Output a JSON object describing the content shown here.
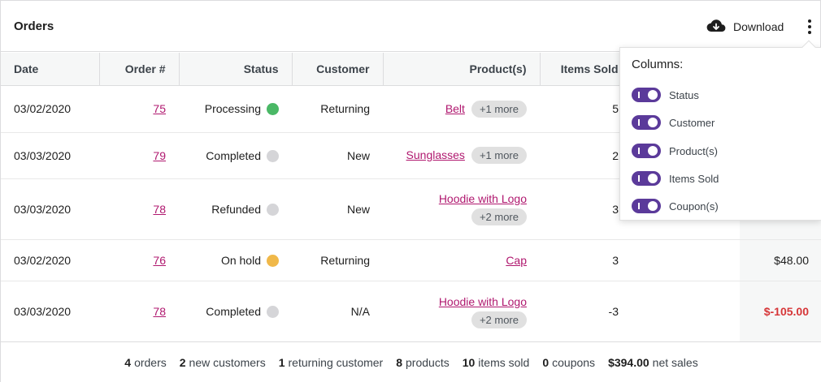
{
  "header": {
    "title": "Orders",
    "download_label": "Download",
    "download_icon": "cloud-download-icon",
    "menu_icon": "vertical-ellipsis-icon"
  },
  "columns": [
    "Date",
    "Order #",
    "Status",
    "Customer",
    "Product(s)",
    "Items Sold"
  ],
  "rows": [
    {
      "date": "03/02/2020",
      "order": "75",
      "status": "Processing",
      "status_color": "#4ab866",
      "customer": "Returning",
      "product": "Belt",
      "more": "+1 more",
      "items": "5",
      "net": ""
    },
    {
      "date": "03/03/2020",
      "order": "79",
      "status": "Completed",
      "status_color": "#d5d5d8",
      "customer": "New",
      "product": "Sunglasses",
      "more": "+1 more",
      "items": "2",
      "net": ""
    },
    {
      "date": "03/03/2020",
      "order": "78",
      "status": "Refunded",
      "status_color": "#d5d5d8",
      "customer": "New",
      "product": "Hoodie with Logo",
      "more": "+2 more",
      "items": "3",
      "net": ""
    },
    {
      "date": "03/02/2020",
      "order": "76",
      "status": "On hold",
      "status_color": "#f0b849",
      "customer": "Returning",
      "product": "Cap",
      "more": "",
      "items": "3",
      "net": "$48.00"
    },
    {
      "date": "03/03/2020",
      "order": "78",
      "status": "Completed",
      "status_color": "#d5d5d8",
      "customer": "N/A",
      "product": "Hoodie with Logo",
      "more": "+2 more",
      "items": "-3",
      "net": "$-105.00"
    }
  ],
  "summary": [
    {
      "value": "4",
      "label": "orders"
    },
    {
      "value": "2",
      "label": "new customers"
    },
    {
      "value": "1",
      "label": "returning customer"
    },
    {
      "value": "8",
      "label": "products"
    },
    {
      "value": "10",
      "label": "items sold"
    },
    {
      "value": "0",
      "label": "coupons"
    },
    {
      "value": "$394.00",
      "label": "net sales"
    }
  ],
  "popover": {
    "title": "Columns:",
    "toggles": [
      {
        "label": "Status",
        "on": true
      },
      {
        "label": "Customer",
        "on": true
      },
      {
        "label": "Product(s)",
        "on": true
      },
      {
        "label": "Items Sold",
        "on": true
      },
      {
        "label": "Coupon(s)",
        "on": true
      }
    ]
  },
  "colors": {
    "accent": "#5b3a9a",
    "link": "#b0186f",
    "negative": "#d63638"
  }
}
